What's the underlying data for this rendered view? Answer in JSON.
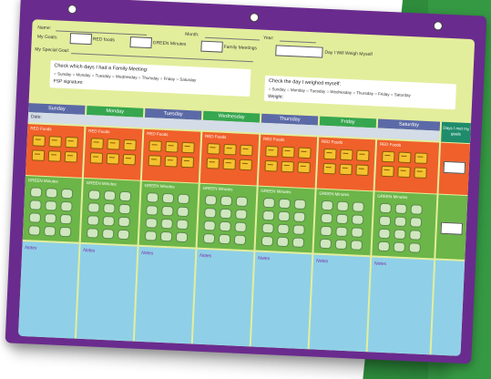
{
  "header": {
    "name_label": "Name:",
    "month_label": "Month:",
    "year_label": "Year:",
    "goals_label": "My Goals:",
    "red_foods_label": "RED foods",
    "green_minutes_label": "GREEN Minutes",
    "family_meetings_label": "Family Meetings",
    "weigh_label": "Day I Will Weigh Myself",
    "special_goal_label": "My Special Goal:"
  },
  "meeting_box": {
    "title": "Check which days I had a Family Meeting:",
    "days": "○ Sunday  ○ Monday  ○ Tuesday  ○ Wednesday  ○ Thursday  ○ Friday  ○ Saturday",
    "signature": "FSP signature:"
  },
  "weigh_box": {
    "title": "Check the day I weighed myself:",
    "days": "○ Sunday  ○ Monday  ○ Tuesday  ○ Wednesday  ○ Thursday  ○ Friday  ○ Saturday",
    "weight": "Weight:"
  },
  "days": [
    {
      "name": "Sunday",
      "color": "#5b6aa6"
    },
    {
      "name": "Monday",
      "color": "#36a64f"
    },
    {
      "name": "Tuesday",
      "color": "#5b6aa6"
    },
    {
      "name": "Wednesday",
      "color": "#36a64f"
    },
    {
      "name": "Thursday",
      "color": "#5b6aa6"
    },
    {
      "name": "Friday",
      "color": "#36a64f"
    },
    {
      "name": "Saturday",
      "color": "#5b6aa6"
    }
  ],
  "date_label": "Date:",
  "red_foods_cell": "RED Foods",
  "green_minutes_cell": "GREEN Minutes",
  "notes_cell": "Notes",
  "goal_column_label": "Days I met my goals",
  "colors": {
    "frame": "#6a2b8e",
    "sheet": "#e3ee9c",
    "red": "#f0602a",
    "green": "#6cb548",
    "notes": "#8fd0e8",
    "goal_header": "#1e8c6a"
  }
}
